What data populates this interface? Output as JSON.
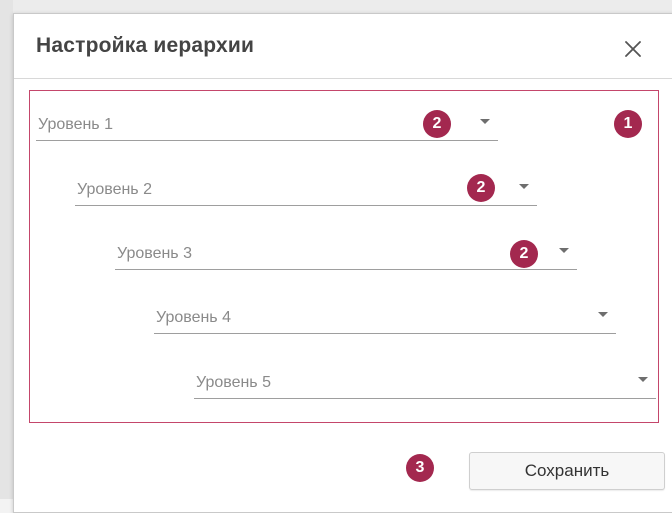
{
  "dialog": {
    "title": "Настройка иерархии",
    "close_icon": "close-icon"
  },
  "levels": [
    {
      "label": "Уровень 1"
    },
    {
      "label": "Уровень 2"
    },
    {
      "label": "Уровень 3"
    },
    {
      "label": "Уровень 4"
    },
    {
      "label": "Уровень 5"
    }
  ],
  "badges": {
    "hierarchy_box": "1",
    "level_1": "2",
    "level_2": "2",
    "level_3": "2",
    "save": "3"
  },
  "footer": {
    "save_label": "Сохранить"
  },
  "colors": {
    "highlight_border": "#c4466b",
    "badge": "#a3284f"
  }
}
